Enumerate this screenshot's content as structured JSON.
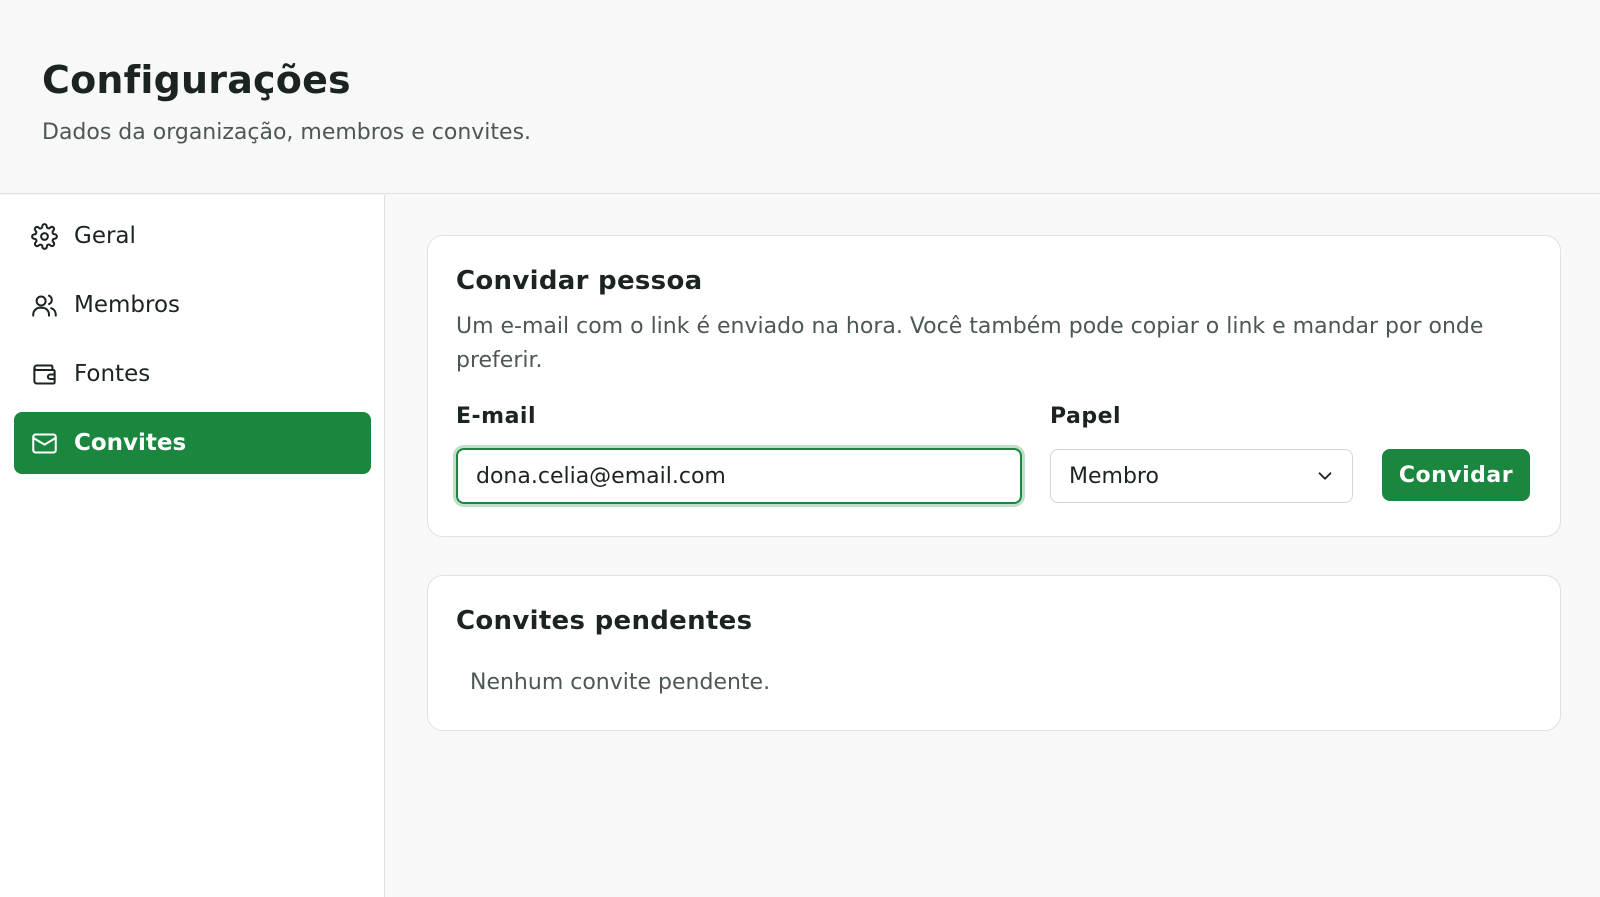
{
  "header": {
    "title": "Configurações",
    "subtitle": "Dados da organização, membros e convites."
  },
  "sidebar": {
    "items": [
      {
        "label": "Geral",
        "icon": "gear-icon",
        "active": false
      },
      {
        "label": "Membros",
        "icon": "users-icon",
        "active": false
      },
      {
        "label": "Fontes",
        "icon": "wallet-icon",
        "active": false
      },
      {
        "label": "Convites",
        "icon": "mail-icon",
        "active": true
      }
    ]
  },
  "invite_card": {
    "title": "Convidar pessoa",
    "description": "Um e-mail com o link é enviado na hora. Você também pode copiar o link e mandar por onde preferir.",
    "email_label": "E-mail",
    "email_value": "dona.celia@email.com",
    "role_label": "Papel",
    "role_value": "Membro",
    "submit_label": "Convidar"
  },
  "pending_card": {
    "title": "Convites pendentes",
    "empty_message": "Nenhum convite pendente."
  },
  "colors": {
    "accent": "#1b873e",
    "text": "#1c2420",
    "muted": "#4e5852",
    "background": "#f7f8f7"
  }
}
